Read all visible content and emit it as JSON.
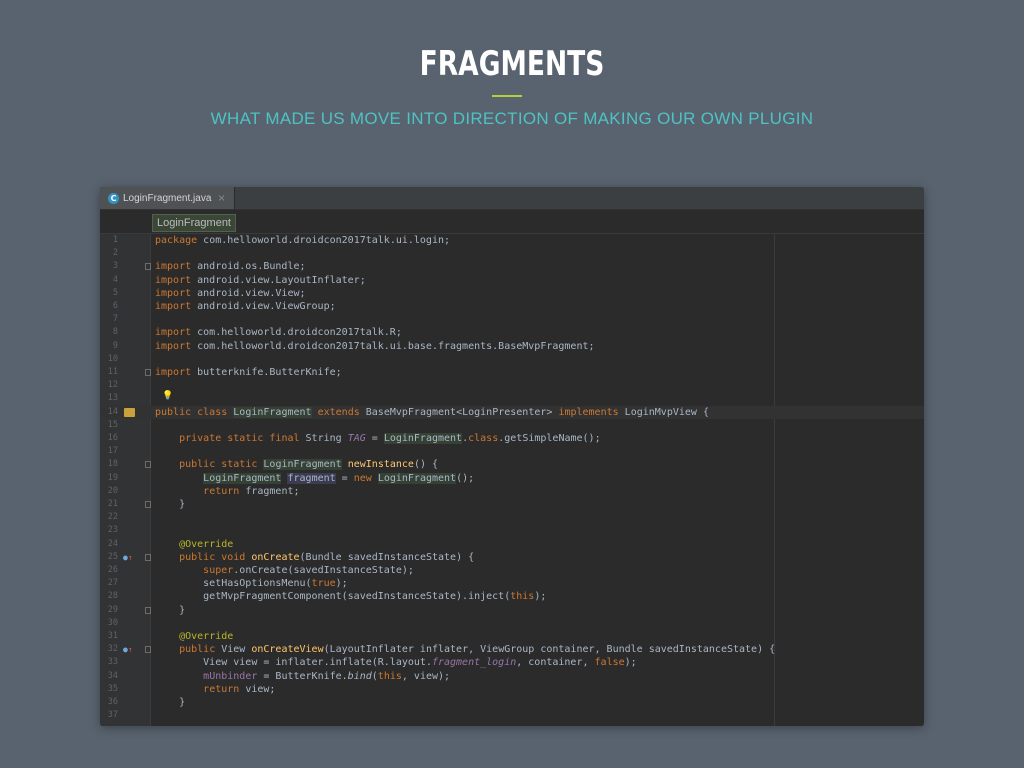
{
  "slide": {
    "title": "FRAGMENTS",
    "subtitle": "WHAT MADE US MOVE INTO DIRECTION OF MAKING OUR OWN PLUGIN"
  },
  "editor": {
    "tab": {
      "icon": "class-icon",
      "icon_letter": "C",
      "label": "LoginFragment.java",
      "close": "×"
    },
    "breadcrumb": "LoginFragment",
    "current_line": 14,
    "lines": [
      {
        "n": "1",
        "html": "<span class='kw'>package</span> com.helloworld.droidcon2017talk.ui.login;"
      },
      {
        "n": "2",
        "html": ""
      },
      {
        "n": "3",
        "html": "<span class='kw'>import</span> android.os.Bundle;",
        "fold": true
      },
      {
        "n": "4",
        "html": "<span class='kw'>import</span> android.view.LayoutInflater;"
      },
      {
        "n": "5",
        "html": "<span class='kw'>import</span> android.view.View;"
      },
      {
        "n": "6",
        "html": "<span class='kw'>import</span> android.view.ViewGroup;"
      },
      {
        "n": "7",
        "html": ""
      },
      {
        "n": "8",
        "html": "<span class='kw'>import</span> com.helloworld.droidcon2017talk.R;"
      },
      {
        "n": "9",
        "html": "<span class='kw'>import</span> com.helloworld.droidcon2017talk.ui.base.fragments.BaseMvpFragment;"
      },
      {
        "n": "10",
        "html": ""
      },
      {
        "n": "11",
        "html": "<span class='kw'>import</span> butterknife.ButterKnife;",
        "fold": true
      },
      {
        "n": "12",
        "html": ""
      },
      {
        "n": "13",
        "html": ""
      },
      {
        "n": "14",
        "html": "<span class='kw'>public class</span> <span class='hl'>LoginFragment</span> <span class='kw'>extends</span> BaseMvpFragment&lt;LoginPresenter&gt; <span class='kw'>implements</span> LoginMvpView {",
        "icon": "implements-icon"
      },
      {
        "n": "15",
        "html": ""
      },
      {
        "n": "16",
        "html": "    <span class='kw'>private static final</span> String <span class='fldi'>TAG</span> = <span class='hl'>LoginFragment</span>.<span class='kw'>class</span>.getSimpleName();"
      },
      {
        "n": "17",
        "html": ""
      },
      {
        "n": "18",
        "html": "    <span class='kw'>public static</span> <span class='hl'>LoginFragment</span> <span class='fn'>newInstance</span>() {",
        "fold": true
      },
      {
        "n": "19",
        "html": "        <span class='hl'>LoginFragment</span> <span class='hlv'>fragment</span> = <span class='kw'>new</span> <span class='hl'>LoginFragment</span>();"
      },
      {
        "n": "20",
        "html": "        <span class='kw'>return</span> fragment;"
      },
      {
        "n": "21",
        "html": "    }",
        "fold": true
      },
      {
        "n": "22",
        "html": ""
      },
      {
        "n": "23",
        "html": ""
      },
      {
        "n": "24",
        "html": "    <span class='ann'>@Override</span>"
      },
      {
        "n": "25",
        "html": "    <span class='kw'>public void</span> <span class='fn'>onCreate</span>(Bundle savedInstanceState) {",
        "fold": true,
        "icon": "override-icon"
      },
      {
        "n": "26",
        "html": "        <span class='kw'>super</span>.onCreate(savedInstanceState);"
      },
      {
        "n": "27",
        "html": "        setHasOptionsMenu(<span class='kw'>true</span>);"
      },
      {
        "n": "28",
        "html": "        getMvpFragmentComponent(savedInstanceState).inject(<span class='kw'>this</span>);"
      },
      {
        "n": "29",
        "html": "    }",
        "fold": true
      },
      {
        "n": "30",
        "html": ""
      },
      {
        "n": "31",
        "html": "    <span class='ann'>@Override</span>"
      },
      {
        "n": "32",
        "html": "    <span class='kw'>public</span> View <span class='fn'>onCreateView</span>(LayoutInflater inflater, ViewGroup container, Bundle savedInstanceState) {",
        "fold": true,
        "icon": "override-icon"
      },
      {
        "n": "33",
        "html": "        View view = inflater.inflate(R.layout.<span class='fldi'>fragment_login</span>, container, <span class='kw'>false</span>);"
      },
      {
        "n": "34",
        "html": "        <span class='fld'>mUnbinder</span> = ButterKnife.<span class='ital'>bind</span>(<span class='kw'>this</span>, view);"
      },
      {
        "n": "35",
        "html": "        <span class='kw'>return</span> view;"
      },
      {
        "n": "36",
        "html": "    }"
      },
      {
        "n": "37",
        "html": ""
      }
    ]
  }
}
